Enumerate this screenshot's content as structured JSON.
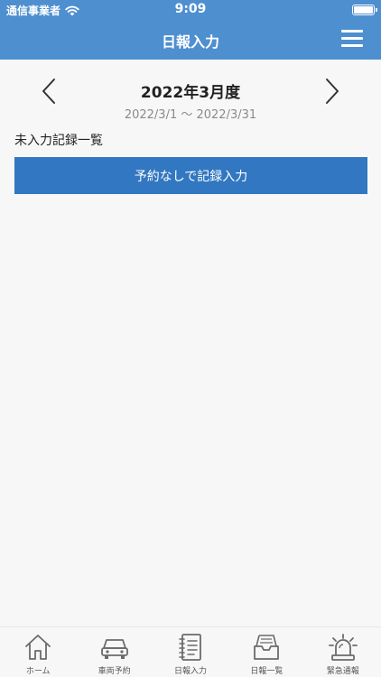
{
  "status": {
    "carrier": "通信事業者",
    "time": "9:09"
  },
  "header": {
    "title": "日報入力"
  },
  "month_nav": {
    "title": "2022年3月度",
    "range": "2022/3/1 〜 2022/3/31"
  },
  "section": {
    "label": "未入力記録一覧"
  },
  "actions": {
    "entry_without_reservation": "予約なしで記録入力"
  },
  "tabs": [
    {
      "label": "ホーム",
      "icon": "home-icon"
    },
    {
      "label": "車両予約",
      "icon": "car-icon"
    },
    {
      "label": "日報入力",
      "icon": "notebook-icon"
    },
    {
      "label": "日報一覧",
      "icon": "inbox-tray-icon"
    },
    {
      "label": "緊急通報",
      "icon": "alarm-light-icon"
    }
  ],
  "colors": {
    "primary": "#4e8fd0",
    "button": "#3277c1",
    "background": "#f7f7f7"
  }
}
